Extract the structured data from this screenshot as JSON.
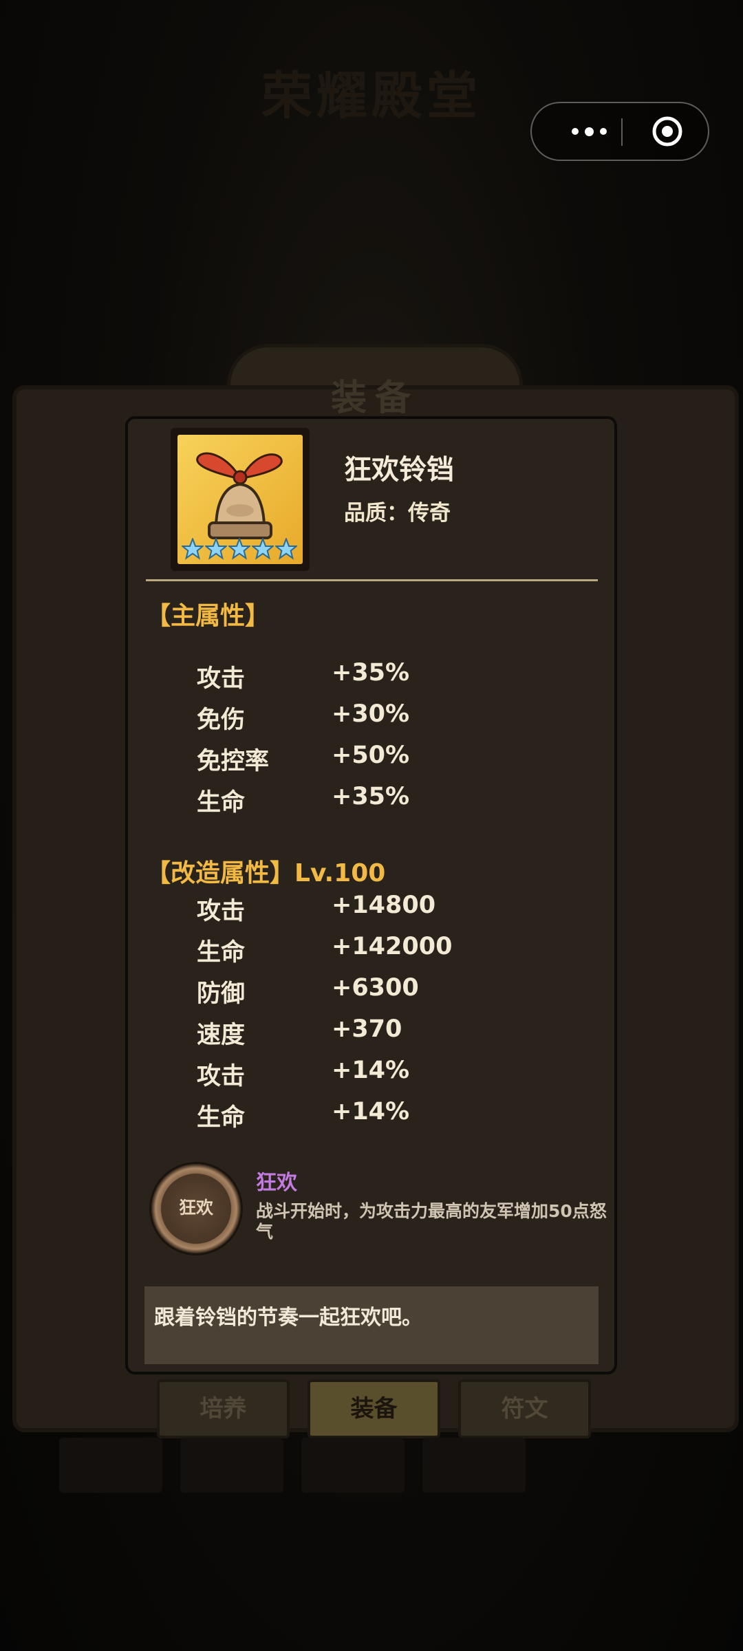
{
  "background": {
    "hall_title": "荣耀殿堂",
    "screen_title": "装备",
    "tabs": [
      {
        "label": "培养",
        "active": false
      },
      {
        "label": "装备",
        "active": true
      },
      {
        "label": "符文",
        "active": false
      }
    ]
  },
  "capsule": {
    "more_icon": "more-dots-icon",
    "close_icon": "target-close-icon"
  },
  "item": {
    "name": "狂欢铃铛",
    "quality_label": "品质：传奇",
    "stars": 5,
    "icon": "bell-icon"
  },
  "main_attributes": {
    "title": "【主属性】",
    "rows": [
      {
        "label": "攻击",
        "value": "+35%"
      },
      {
        "label": "免伤",
        "value": "+30%"
      },
      {
        "label": "免控率",
        "value": "+50%"
      },
      {
        "label": "生命",
        "value": "+35%"
      }
    ]
  },
  "reforge_attributes": {
    "title": "【改造属性】Lv.100",
    "rows": [
      {
        "label": "攻击",
        "value": "+14800"
      },
      {
        "label": "生命",
        "value": "+142000"
      },
      {
        "label": "防御",
        "value": "+6300"
      },
      {
        "label": "速度",
        "value": "+370"
      },
      {
        "label": "攻击",
        "value": "+14%"
      },
      {
        "label": "生命",
        "value": "+14%"
      }
    ]
  },
  "skill": {
    "icon_label": "狂欢",
    "name": "狂欢",
    "description": "战斗开始时，为攻击力最高的友军增加50点怒气"
  },
  "flavor_text": "跟着铃铛的节奏一起狂欢吧。",
  "colors": {
    "section_title": "#f2b944",
    "skill_name": "#c27be0",
    "divider": "#bba982"
  }
}
